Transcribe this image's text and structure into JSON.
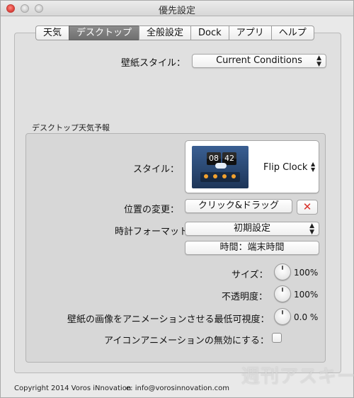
{
  "window": {
    "title": "優先設定"
  },
  "tabs": [
    {
      "label": "天気",
      "active": false
    },
    {
      "label": "デスクトップ",
      "active": true
    },
    {
      "label": "全般設定",
      "active": false
    },
    {
      "label": "Dock",
      "active": false
    },
    {
      "label": "アプリ",
      "active": false
    },
    {
      "label": "ヘルプ",
      "active": false
    }
  ],
  "wallpaper": {
    "label": "壁紙スタイル：",
    "value": "Current Conditions"
  },
  "desktop_forecast": {
    "group_title": "デスクトップ天気予報",
    "style": {
      "label": "スタイル：",
      "value": "Flip Clock",
      "preview_hour": "08",
      "preview_minute": "42"
    },
    "position": {
      "label": "位置の変更：",
      "button_label": "クリック&ドラッグ",
      "reset_icon": "close-icon"
    },
    "clock_format": {
      "label": "時計フォーマット：",
      "value": "初期設定",
      "time_button_label": "時間：端末時間"
    },
    "size": {
      "label": "サイズ：",
      "value": "100%"
    },
    "opacity": {
      "label": "不透明度：",
      "value": "100%"
    },
    "min_visibility": {
      "label": "壁紙の画像をアニメーションさせる最低可視度：",
      "value": "0.0 %"
    },
    "disable_icon_anim": {
      "label": "アイコンアニメーションの無効にする：",
      "checked": false
    }
  },
  "footer": {
    "copyright": "Copyright 2014 Voros iNnovation",
    "email": "e: info@vorosinnovation.com"
  },
  "watermark": "週刊アスキー",
  "colors": {
    "active_tab": "#7d7d7d",
    "close_red": "#d9312a",
    "window_bg": "#e9e9e9"
  }
}
